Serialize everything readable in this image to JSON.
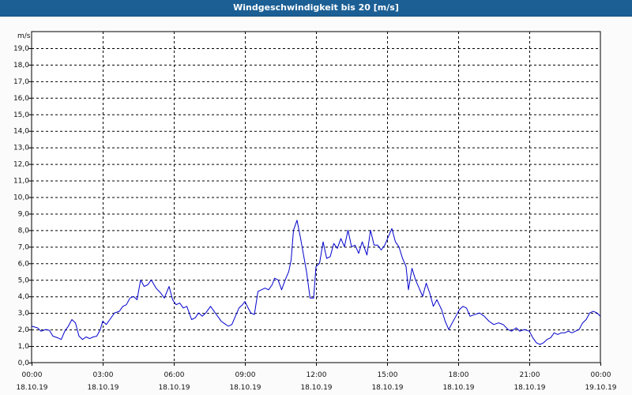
{
  "window": {
    "title": "Windgeschwindigkeit bis 20 [m/s]"
  },
  "colors": {
    "titlebar": "#1B5F95",
    "series": "#0000CC",
    "grid": "#000000",
    "background": "#FFFFFF"
  },
  "chart_data": {
    "type": "line",
    "title": "Windgeschwindigkeit bis 20 [m/s]",
    "ylabel": "m/s",
    "xlabel": "",
    "ylim": [
      0,
      20
    ],
    "xlim_hours": [
      0,
      24
    ],
    "grid": true,
    "y_ticks": [
      "0,0",
      "1,0",
      "2,0",
      "3,0",
      "4,0",
      "5,0",
      "6,0",
      "7,0",
      "8,0",
      "9,0",
      "10,0",
      "11,0",
      "12,0",
      "13,0",
      "14,0",
      "15,0",
      "16,0",
      "17,0",
      "18,0",
      "19,0"
    ],
    "x_ticks": [
      {
        "time": "00:00",
        "date": "18.10.19"
      },
      {
        "time": "03:00",
        "date": "18.10.19"
      },
      {
        "time": "06:00",
        "date": "18.10.19"
      },
      {
        "time": "09:00",
        "date": "18.10.19"
      },
      {
        "time": "12:00",
        "date": "18.10.19"
      },
      {
        "time": "15:00",
        "date": "18.10.19"
      },
      {
        "time": "18:00",
        "date": "18.10.19"
      },
      {
        "time": "21:00",
        "date": "18.10.19"
      },
      {
        "time": "00:00",
        "date": "19.10.19"
      }
    ],
    "series": [
      {
        "points": [
          [
            0.0,
            2.2
          ],
          [
            0.25,
            2.1
          ],
          [
            0.4,
            1.9
          ],
          [
            0.6,
            2.0
          ],
          [
            0.75,
            1.95
          ],
          [
            0.9,
            1.6
          ],
          [
            1.1,
            1.5
          ],
          [
            1.25,
            1.4
          ],
          [
            1.4,
            1.9
          ],
          [
            1.55,
            2.2
          ],
          [
            1.7,
            2.6
          ],
          [
            1.85,
            2.4
          ],
          [
            2.0,
            1.6
          ],
          [
            2.15,
            1.4
          ],
          [
            2.3,
            1.55
          ],
          [
            2.45,
            1.45
          ],
          [
            2.6,
            1.55
          ],
          [
            2.75,
            1.6
          ],
          [
            2.9,
            2.0
          ],
          [
            3.0,
            2.5
          ],
          [
            3.15,
            2.3
          ],
          [
            3.3,
            2.6
          ],
          [
            3.5,
            3.0
          ],
          [
            3.7,
            3.1
          ],
          [
            3.85,
            3.4
          ],
          [
            4.0,
            3.5
          ],
          [
            4.15,
            3.9
          ],
          [
            4.3,
            4.0
          ],
          [
            4.45,
            3.8
          ],
          [
            4.6,
            5.0
          ],
          [
            4.75,
            4.6
          ],
          [
            4.9,
            4.7
          ],
          [
            5.05,
            5.0
          ],
          [
            5.25,
            4.5
          ],
          [
            5.45,
            4.2
          ],
          [
            5.6,
            3.9
          ],
          [
            5.8,
            4.6
          ],
          [
            5.95,
            3.8
          ],
          [
            6.1,
            3.5
          ],
          [
            6.25,
            3.6
          ],
          [
            6.4,
            3.3
          ],
          [
            6.55,
            3.4
          ],
          [
            6.75,
            2.6
          ],
          [
            6.9,
            2.7
          ],
          [
            7.05,
            3.0
          ],
          [
            7.2,
            2.8
          ],
          [
            7.35,
            3.0
          ],
          [
            7.55,
            3.4
          ],
          [
            7.7,
            3.1
          ],
          [
            7.85,
            2.8
          ],
          [
            8.0,
            2.5
          ],
          [
            8.15,
            2.35
          ],
          [
            8.3,
            2.2
          ],
          [
            8.45,
            2.3
          ],
          [
            8.6,
            2.8
          ],
          [
            8.75,
            3.3
          ],
          [
            8.9,
            3.5
          ],
          [
            9.0,
            3.7
          ],
          [
            9.1,
            3.4
          ],
          [
            9.25,
            3.0
          ],
          [
            9.4,
            2.9
          ],
          [
            9.55,
            4.3
          ],
          [
            9.7,
            4.4
          ],
          [
            9.85,
            4.5
          ],
          [
            10.0,
            4.4
          ],
          [
            10.15,
            4.7
          ],
          [
            10.25,
            5.1
          ],
          [
            10.4,
            5.0
          ],
          [
            10.55,
            4.4
          ],
          [
            10.7,
            5.0
          ],
          [
            10.85,
            5.5
          ],
          [
            10.95,
            6.2
          ],
          [
            11.05,
            8.0
          ],
          [
            11.2,
            8.6
          ],
          [
            11.35,
            7.5
          ],
          [
            11.5,
            6.3
          ],
          [
            11.6,
            5.5
          ],
          [
            11.75,
            3.9
          ],
          [
            11.9,
            3.9
          ],
          [
            12.0,
            5.8
          ],
          [
            12.15,
            6.0
          ],
          [
            12.3,
            7.3
          ],
          [
            12.45,
            6.3
          ],
          [
            12.6,
            6.4
          ],
          [
            12.75,
            7.2
          ],
          [
            12.9,
            6.9
          ],
          [
            13.05,
            7.5
          ],
          [
            13.2,
            7.0
          ],
          [
            13.35,
            8.0
          ],
          [
            13.5,
            7.0
          ],
          [
            13.65,
            7.1
          ],
          [
            13.8,
            6.6
          ],
          [
            13.95,
            7.3
          ],
          [
            14.15,
            6.5
          ],
          [
            14.3,
            8.0
          ],
          [
            14.45,
            7.1
          ],
          [
            14.6,
            7.1
          ],
          [
            14.75,
            6.8
          ],
          [
            14.9,
            7.1
          ],
          [
            15.05,
            7.6
          ],
          [
            15.2,
            8.1
          ],
          [
            15.35,
            7.3
          ],
          [
            15.5,
            7.0
          ],
          [
            15.65,
            6.3
          ],
          [
            15.8,
            5.8
          ],
          [
            15.9,
            4.4
          ],
          [
            16.05,
            5.7
          ],
          [
            16.2,
            5.0
          ],
          [
            16.35,
            4.5
          ],
          [
            16.5,
            4.0
          ],
          [
            16.65,
            4.8
          ],
          [
            16.8,
            4.2
          ],
          [
            16.95,
            3.4
          ],
          [
            17.1,
            3.8
          ],
          [
            17.3,
            3.2
          ],
          [
            17.45,
            2.5
          ],
          [
            17.6,
            2.0
          ],
          [
            17.75,
            2.4
          ],
          [
            17.9,
            2.8
          ],
          [
            18.05,
            3.2
          ],
          [
            18.2,
            3.4
          ],
          [
            18.35,
            3.3
          ],
          [
            18.5,
            2.8
          ],
          [
            18.7,
            2.9
          ],
          [
            18.9,
            3.0
          ],
          [
            19.1,
            2.8
          ],
          [
            19.3,
            2.5
          ],
          [
            19.5,
            2.3
          ],
          [
            19.7,
            2.4
          ],
          [
            19.9,
            2.3
          ],
          [
            20.1,
            2.0
          ],
          [
            20.25,
            1.9
          ],
          [
            20.45,
            2.1
          ],
          [
            20.6,
            1.9
          ],
          [
            20.8,
            2.0
          ],
          [
            21.0,
            1.9
          ],
          [
            21.15,
            1.5
          ],
          [
            21.3,
            1.2
          ],
          [
            21.45,
            1.1
          ],
          [
            21.6,
            1.2
          ],
          [
            21.75,
            1.4
          ],
          [
            21.9,
            1.5
          ],
          [
            22.05,
            1.8
          ],
          [
            22.2,
            1.7
          ],
          [
            22.35,
            1.8
          ],
          [
            22.5,
            1.8
          ],
          [
            22.65,
            1.9
          ],
          [
            22.8,
            1.8
          ],
          [
            22.95,
            1.9
          ],
          [
            23.1,
            2.0
          ],
          [
            23.25,
            2.4
          ],
          [
            23.4,
            2.6
          ],
          [
            23.55,
            3.0
          ],
          [
            23.7,
            3.1
          ],
          [
            23.85,
            3.0
          ],
          [
            24.0,
            2.8
          ]
        ]
      }
    ]
  }
}
